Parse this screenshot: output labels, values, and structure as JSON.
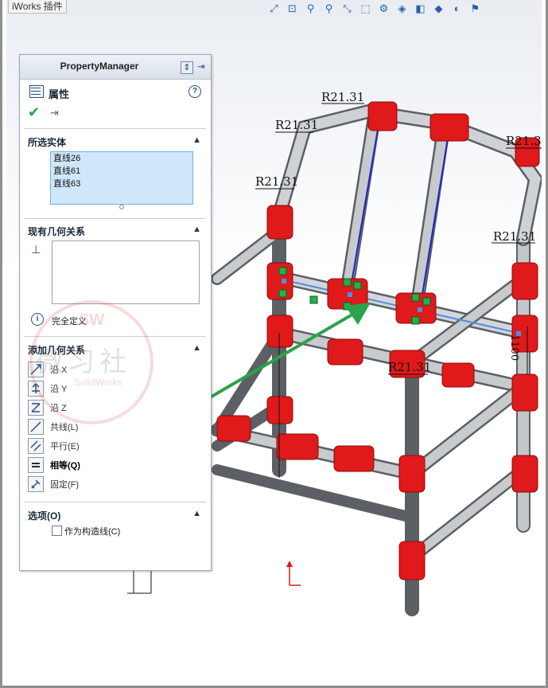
{
  "app": {
    "title_fragment": "iWorks 插件"
  },
  "toolbar": {
    "icons": [
      "zoom-fit-icon",
      "zoom-area-icon",
      "previous-view-icon",
      "section-view-icon",
      "dynamic-annotation-icon",
      "view-orientation-icon",
      "display-style-icon",
      "hide-show-icon",
      "edit-appearance-icon",
      "apply-scene-icon",
      "view-settings-icon",
      "expand-icon"
    ]
  },
  "property_manager": {
    "header_title": "PropertyManager",
    "feature_title": "属性",
    "ok_symbol": "✔",
    "pin_symbol": "⇥",
    "selected_entities": {
      "title": "所选实体",
      "items": [
        "直线26",
        "直线61",
        "直线63"
      ]
    },
    "existing_relations": {
      "title": "现有几何关系",
      "status": "完全定义"
    },
    "add_relations": {
      "title": "添加几何关系",
      "items": [
        {
          "label": "沿 X",
          "icon": "horizontal-x-icon",
          "active": false
        },
        {
          "label": "沿 Y",
          "icon": "vertical-y-icon",
          "active": false
        },
        {
          "label": "沿 Z",
          "icon": "along-z-icon",
          "active": false
        },
        {
          "label": "共线(L)",
          "icon": "collinear-icon",
          "active": false
        },
        {
          "label": "平行(E)",
          "icon": "parallel-icon",
          "active": false
        },
        {
          "label": "相等(Q)",
          "icon": "equal-icon",
          "active": true
        },
        {
          "label": "固定(F)",
          "icon": "fix-icon",
          "active": false
        }
      ]
    },
    "options": {
      "title": "选项(O)",
      "construction_label": "作为构造线(C)",
      "construction_checked": false
    }
  },
  "watermark": {
    "text": "微习社",
    "logo": "SW",
    "sub": "SolidWorks"
  },
  "dimensions": [
    "R21.31",
    "R21.31",
    "R21.31",
    "R21.3",
    "R21.31",
    "R21.31",
    "1100"
  ],
  "colors": {
    "accent": "#2aa34a",
    "joint": "#e0191b",
    "tube": "#b9bcc0",
    "selected_line": "#2323c8"
  }
}
